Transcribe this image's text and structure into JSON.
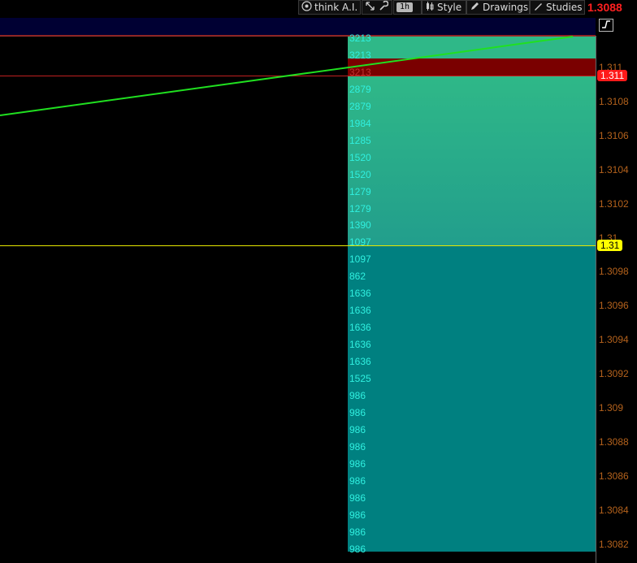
{
  "toolbar": {
    "think_ai": "think A.I.",
    "timeframe": "1h",
    "style": "Style",
    "drawings": "Drawings",
    "studies": "Studies",
    "last_price": "1.3088"
  },
  "corner_icon": "draw-tool-icon",
  "axis": {
    "ticks": [
      "1.311",
      "1.3108",
      "1.3106",
      "1.3104",
      "1.3102",
      "1.31",
      "1.3098",
      "1.3096",
      "1.3094",
      "1.3092",
      "1.309",
      "1.3088",
      "1.3086",
      "1.3084",
      "1.3082"
    ],
    "resistance_tag": "1.311",
    "support_tag": "1.31",
    "colors": {
      "resistance": "#ff2020",
      "support": "#ffff00"
    }
  },
  "volume_profile": {
    "labels": [
      "3213",
      "3213",
      "3213",
      "2879",
      "2879",
      "1984",
      "1285",
      "1520",
      "1520",
      "1279",
      "1279",
      "1390",
      "1097",
      "1097",
      "862",
      "1636",
      "1636",
      "1636",
      "1636",
      "1636",
      "1525",
      "986",
      "986",
      "986",
      "986",
      "986",
      "986",
      "986",
      "986",
      "986",
      "986"
    ],
    "colors": {
      "upper": "#2fb888",
      "highlight": "#7a0000",
      "lower": "#008080"
    }
  },
  "trend_line_color": "#20e020"
}
